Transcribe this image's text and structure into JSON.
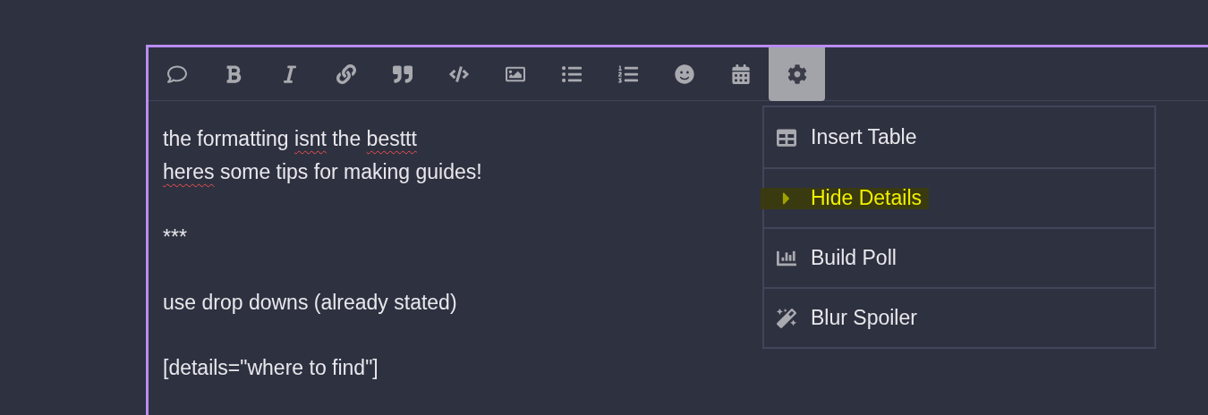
{
  "toolbar": {
    "buttons": [
      {
        "selected": false
      },
      {
        "selected": false
      },
      {
        "selected": false
      },
      {
        "selected": false
      },
      {
        "selected": false
      },
      {
        "selected": false
      },
      {
        "selected": false
      },
      {
        "selected": false
      },
      {
        "selected": false
      },
      {
        "selected": false
      },
      {
        "selected": false
      },
      {
        "selected": true
      }
    ]
  },
  "editor": {
    "blocks": [
      {
        "lines": [
          [
            {
              "text": "the formatting ",
              "misspelled": false
            },
            {
              "text": "isnt",
              "misspelled": true
            },
            {
              "text": " the ",
              "misspelled": false
            },
            {
              "text": "besttt",
              "misspelled": true
            }
          ],
          [
            {
              "text": "heres",
              "misspelled": true
            },
            {
              "text": " some tips for making guides!",
              "misspelled": false
            }
          ]
        ]
      },
      {
        "lines": [
          [
            {
              "text": "***",
              "misspelled": false
            }
          ]
        ]
      },
      {
        "lines": [
          [
            {
              "text": "use drop downs (already stated)",
              "misspelled": false
            }
          ]
        ]
      },
      {
        "lines": [
          [
            {
              "text": "[details=\"where to find\"]",
              "misspelled": false
            }
          ]
        ]
      }
    ]
  },
  "menu": {
    "items": [
      {
        "label": "Insert Table",
        "highlighted": false
      },
      {
        "label": "Hide Details",
        "highlighted": true
      },
      {
        "label": "Build Poll",
        "highlighted": false
      },
      {
        "label": "Blur Spoiler",
        "highlighted": false
      }
    ]
  }
}
